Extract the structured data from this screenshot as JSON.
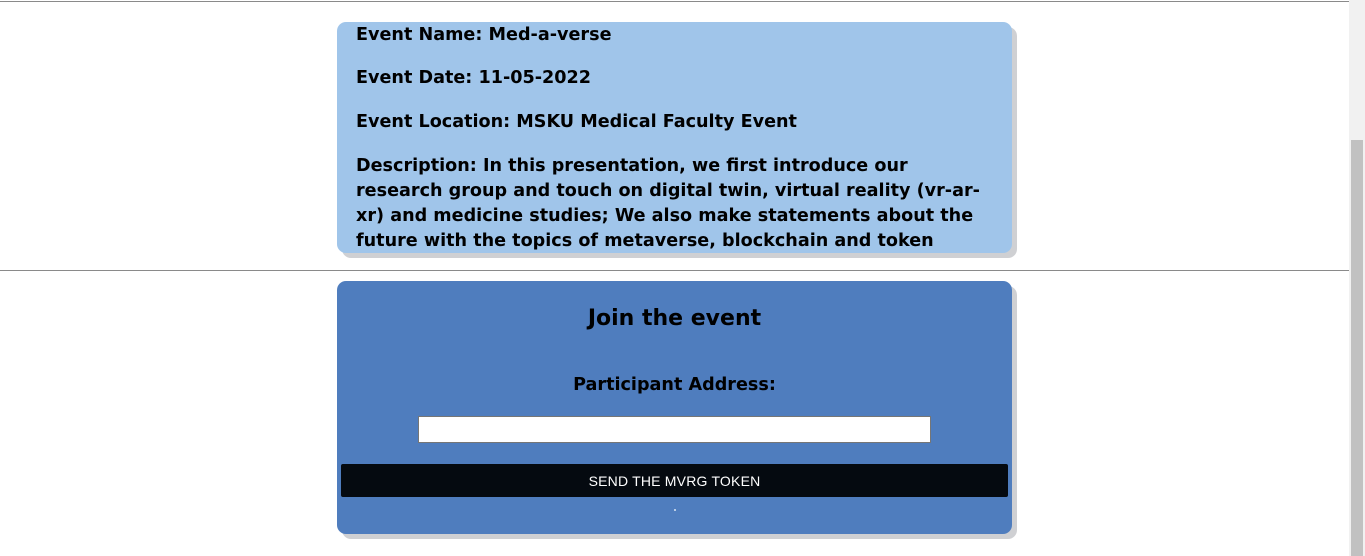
{
  "event": {
    "name_line": "Event Name: Med-a-verse",
    "date_line": "Event Date: 11-05-2022",
    "location_line": "Event Location: MSKU Medical Faculty Event",
    "description_line": "Description: In this presentation, we first introduce our research group and touch on digital twin, virtual reality (vr-ar-xr) and medicine studies; We also make statements about the future with the topics of metaverse, blockchain and token economy."
  },
  "join": {
    "title": "Join the event",
    "participant_label": "Participant Address:",
    "address_value": "",
    "address_placeholder": "",
    "send_label": "SEND THE MVRG TOKEN"
  },
  "colors": {
    "event_card_bg": "#a0c5ea",
    "join_card_bg": "#4f7dbe",
    "button_bg": "#050a10",
    "button_text": "#ffffff"
  }
}
